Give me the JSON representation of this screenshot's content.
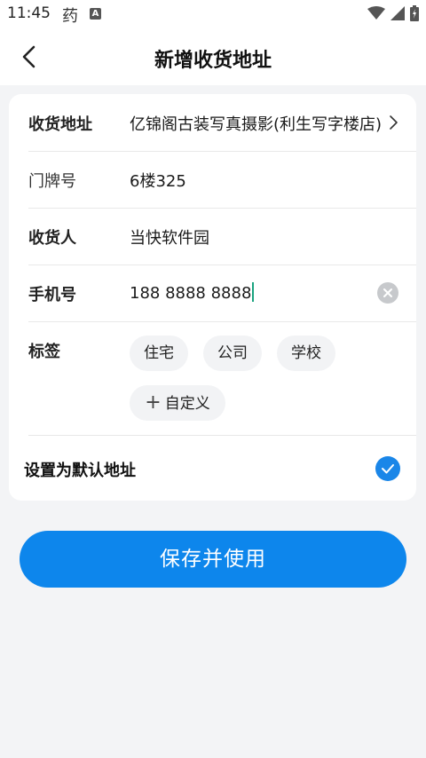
{
  "status_bar": {
    "time": "11:45",
    "app_char": "药",
    "a_badge": "A"
  },
  "header": {
    "title": "新增收货地址"
  },
  "form": {
    "address": {
      "label": "收货地址",
      "value": "亿锦阁古装写真摄影(利生写字楼店)"
    },
    "doorplate": {
      "label": "门牌号",
      "value": "6楼325"
    },
    "receiver": {
      "label": "收货人",
      "value": "当快软件园"
    },
    "phone": {
      "label": "手机号",
      "value": "188 8888 8888"
    },
    "tags": {
      "label": "标签",
      "items": [
        "住宅",
        "公司",
        "学校"
      ],
      "custom": "自定义",
      "custom_plus": "+"
    },
    "default": {
      "label": "设置为默认地址",
      "checked": true
    }
  },
  "actions": {
    "save_label": "保存并使用"
  },
  "colors": {
    "accent": "#0d86ec",
    "check": "#1a86e8",
    "cursor": "#1aa37f"
  }
}
